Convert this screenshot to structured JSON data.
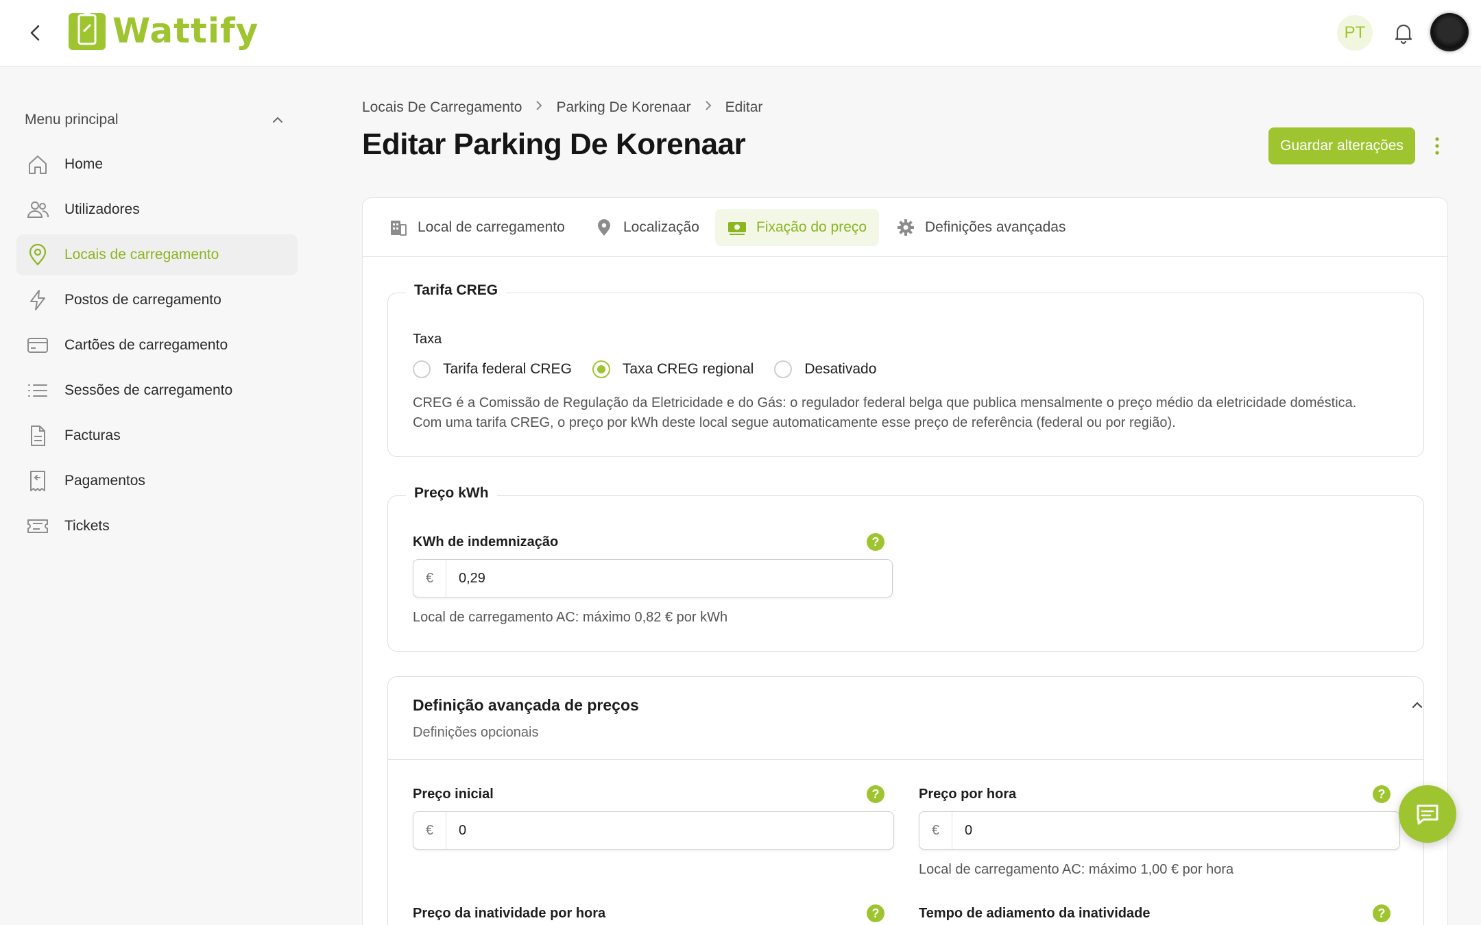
{
  "brand": {
    "name": "Wattify",
    "accent": "#9ec52f"
  },
  "topbar": {
    "language": "PT"
  },
  "sidebar": {
    "menu_title": "Menu principal",
    "items": [
      {
        "label": "Home",
        "icon": "home-icon"
      },
      {
        "label": "Utilizadores",
        "icon": "users-icon"
      },
      {
        "label": "Locais de carregamento",
        "icon": "map-pin-icon",
        "active": true
      },
      {
        "label": "Postos de carregamento",
        "icon": "bolt-icon"
      },
      {
        "label": "Cartões de carregamento",
        "icon": "card-icon"
      },
      {
        "label": "Sessões de carregamento",
        "icon": "list-icon"
      },
      {
        "label": "Facturas",
        "icon": "document-icon"
      },
      {
        "label": "Pagamentos",
        "icon": "receipt-icon"
      },
      {
        "label": "Tickets",
        "icon": "ticket-icon"
      }
    ]
  },
  "breadcrumb": [
    "Locais De Carregamento",
    "Parking De Korenaar",
    "Editar"
  ],
  "page": {
    "title": "Editar Parking De Korenaar",
    "save_label": "Guardar alterações"
  },
  "tabs": [
    {
      "label": "Local de carregamento",
      "icon": "building-icon"
    },
    {
      "label": "Localização",
      "icon": "location-icon"
    },
    {
      "label": "Fixação do preço",
      "icon": "money-icon",
      "active": true
    },
    {
      "label": "Definições avançadas",
      "icon": "gear-icon"
    }
  ],
  "creg": {
    "legend": "Tarifa CREG",
    "taxa_label": "Taxa",
    "options": [
      "Tarifa federal CREG",
      "Taxa CREG regional",
      "Desativado"
    ],
    "selected": "Taxa CREG regional",
    "description_1": "CREG é a Comissão de Regulação da Eletricidade e do Gás: o regulador federal belga que publica mensalmente o preço médio da eletricidade doméstica.",
    "description_2": "Com uma tarifa CREG, o preço por kWh deste local segue automaticamente esse preço de referência (federal ou por região)."
  },
  "kwh": {
    "legend": "Preço kWh",
    "field_label": "KWh de indemnização",
    "currency": "€",
    "value": "0,29",
    "hint": "Local de carregamento AC: máximo 0,82 € por kWh"
  },
  "advanced": {
    "title": "Definição avançada de preços",
    "subtitle": "Definições opcionais",
    "start_price": {
      "label": "Preço inicial",
      "currency": "€",
      "value": "0"
    },
    "hour_price": {
      "label": "Preço por hora",
      "currency": "€",
      "value": "0",
      "hint": "Local de carregamento AC: máximo 1,00 € por hora"
    },
    "idle_price_label": "Preço da inatividade por hora",
    "idle_delay_label": "Tempo de adiamento da inatividade"
  },
  "help_glyph": "?"
}
